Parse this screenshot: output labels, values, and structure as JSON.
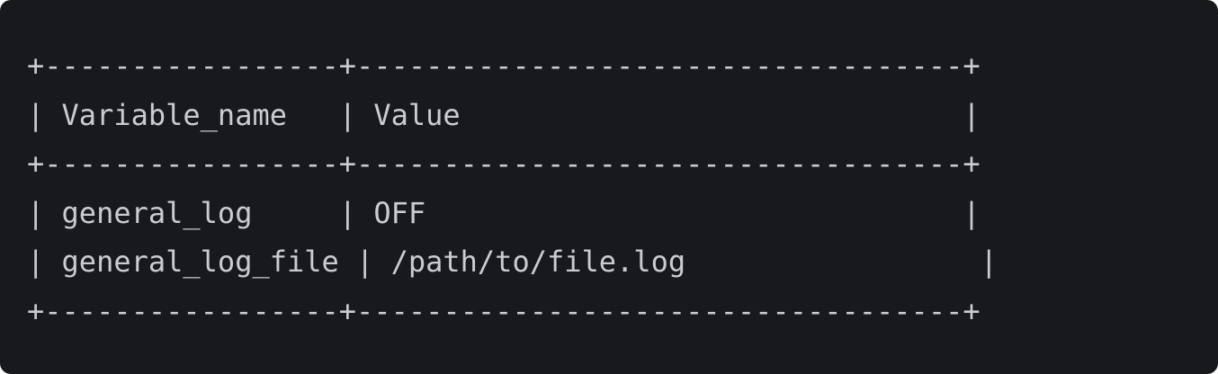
{
  "table": {
    "lines": [
      "+-----------------+-----------------------------------+",
      "| Variable_name   | Value                             |",
      "+-----------------+-----------------------------------+",
      "| general_log     | OFF                               |",
      "| general_log_file | /path/to/file.log                 |",
      "+-----------------+-----------------------------------+"
    ],
    "columns": [
      "Variable_name",
      "Value"
    ],
    "rows": [
      [
        "general_log",
        "OFF"
      ],
      [
        "general_log_file",
        "/path/to/file.log"
      ]
    ]
  },
  "colors": {
    "background": "#18191c",
    "text": "#c9ccd1"
  }
}
